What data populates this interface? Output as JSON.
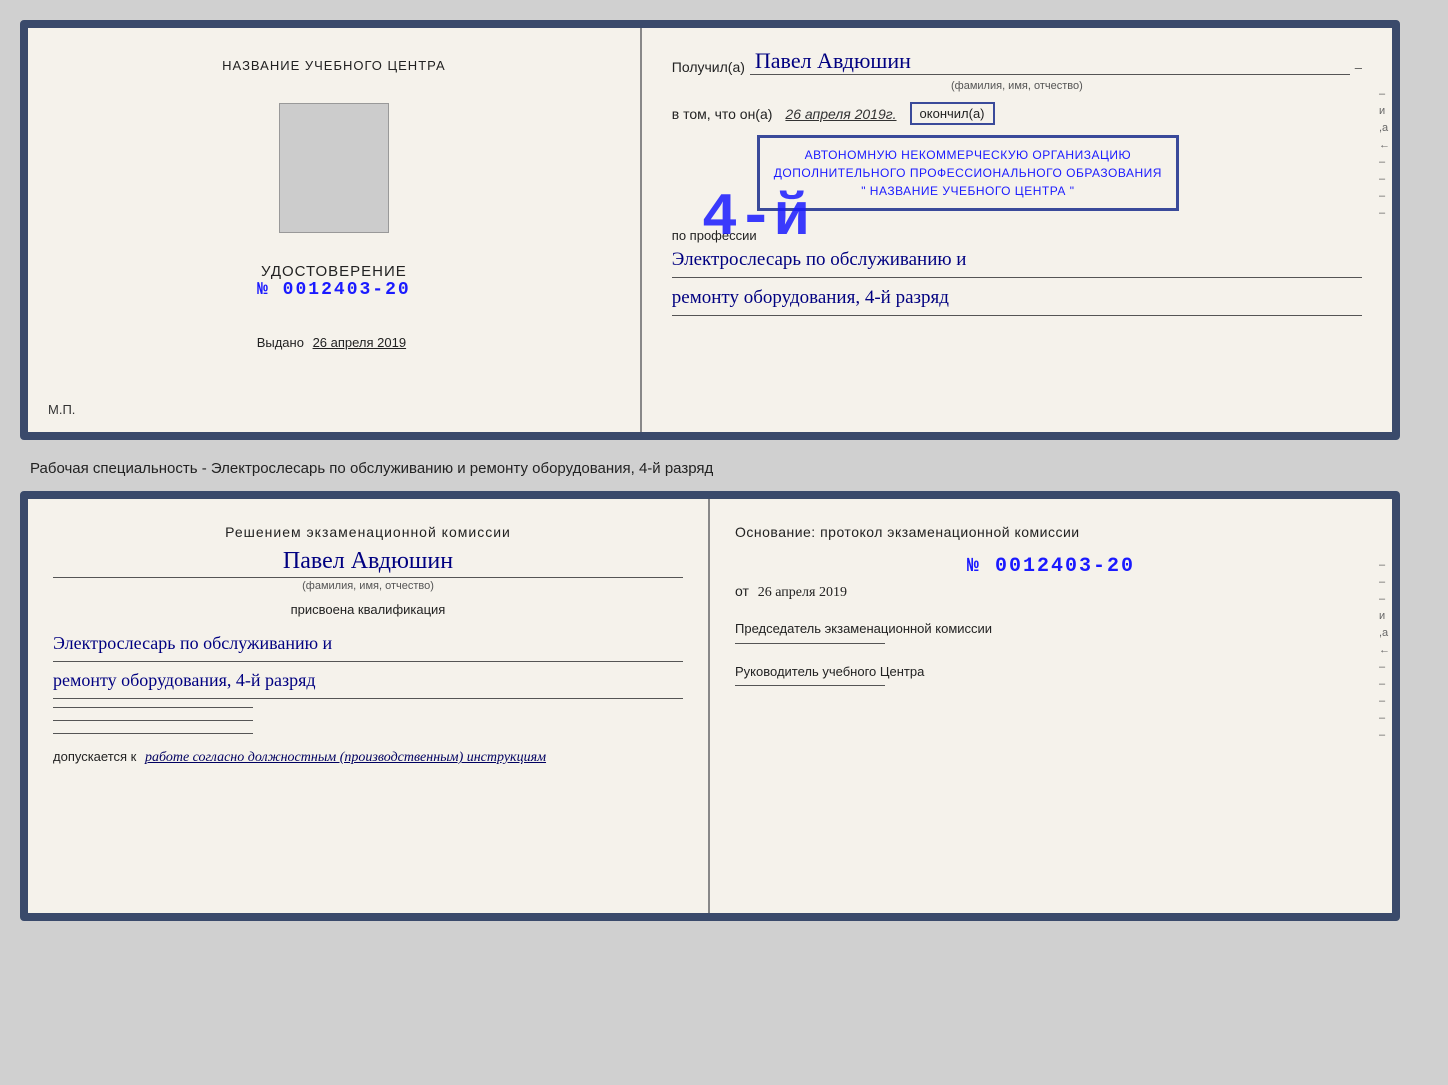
{
  "doc_top": {
    "left": {
      "center_title": "НАЗВАНИЕ УЧЕБНОГО ЦЕНТРА",
      "udostoverenie_title": "УДОСТОВЕРЕНИЕ",
      "udostoverenie_number": "№ 0012403-20",
      "vydano_label": "Выдано",
      "vydano_date": "26 апреля 2019",
      "mp_label": "М.П."
    },
    "right": {
      "poluchil_prefix": "Получил(a)",
      "full_name": "Павел Авдюшин",
      "fio_hint": "(фамилия, имя, отчество)",
      "vtom_prefix": "в том, что он(а)",
      "date_handwritten": "26 апреля 2019г.",
      "okoncil": "окончил(а)",
      "razryad_big": "4-й",
      "org_line1": "АВТОНОМНУЮ НЕКОММЕРЧЕСКУЮ ОРГАНИЗАЦИЮ",
      "org_line2": "ДОПОЛНИТЕЛЬНОГО ПРОФЕССИОНАЛЬНОГО ОБРАЗОВАНИЯ",
      "org_line3": "\" НАЗВАНИЕ УЧЕБНОГО ЦЕНТРА \"",
      "po_professii": "по профессии",
      "profession_line1": "Электрослесарь по обслуживанию и",
      "profession_line2": "ремонту оборудования, 4-й разряд"
    }
  },
  "middle_text": "Рабочая специальность - Электрослесарь по обслуживанию и ремонту оборудования, 4-й разряд",
  "doc_bottom": {
    "left": {
      "komissia_title": "Решением экзаменационной комиссии",
      "full_name": "Павел Авдюшин",
      "fio_hint": "(фамилия, имя, отчество)",
      "prisvoena": "присвоена квалификация",
      "profession_line1": "Электрослесарь по обслуживанию и",
      "profession_line2": "ремонту оборудования, 4-й разряд",
      "dopuskaetsya_prefix": "допускается к",
      "dopuskaetsya_text": "работе согласно должностным (производственным) инструкциям"
    },
    "right": {
      "osnovaniye_label": "Основание: протокол экзаменационной комиссии",
      "number": "№ 0012403-20",
      "ot_prefix": "от",
      "ot_date": "26 апреля 2019",
      "chairman_title": "Председатель экзаменационной комиссии",
      "rukovoditel_title": "Руководитель учебного Центра"
    }
  }
}
